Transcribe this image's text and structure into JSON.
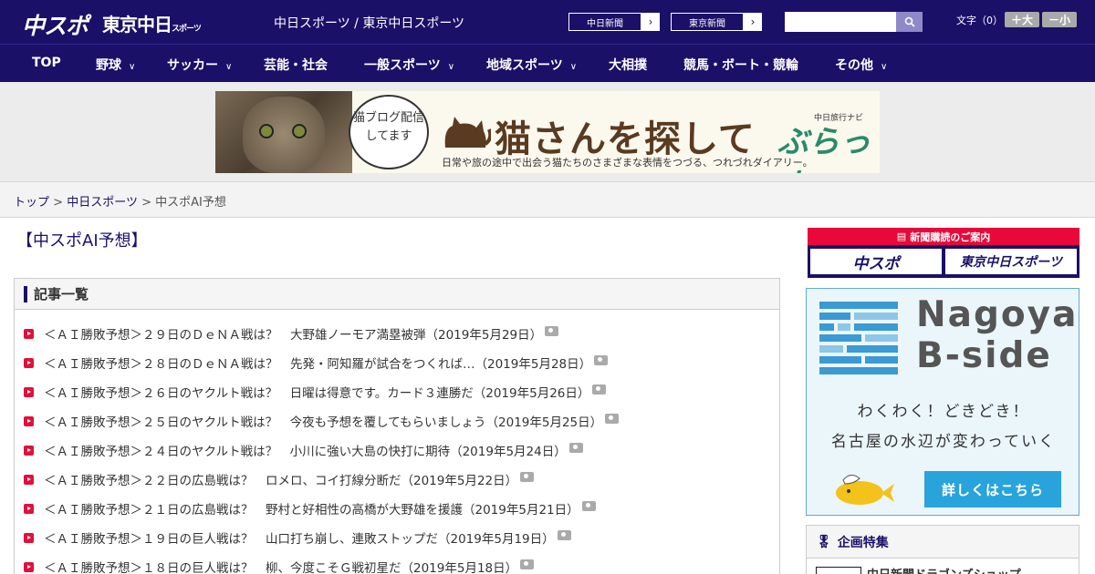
{
  "header": {
    "logo_main": "中スポ",
    "logo_tokyo": "東京中日",
    "logo_tokyo_small": "スポーツ",
    "site_title": "中日スポーツ / 東京中日スポーツ",
    "btn_chunichi": "中日新聞",
    "btn_tokyo": "東京新聞",
    "search_placeholder": "",
    "font_size_label": "文字（0）",
    "font_bigger": "＋大",
    "font_smaller": "－小"
  },
  "nav": {
    "items": [
      {
        "label": "TOP",
        "chevron": false
      },
      {
        "label": "野球",
        "chevron": true
      },
      {
        "label": "サッカー",
        "chevron": true
      },
      {
        "label": "芸能・社会",
        "chevron": false
      },
      {
        "label": "一般スポーツ",
        "chevron": true
      },
      {
        "label": "地域スポーツ",
        "chevron": true
      },
      {
        "label": "大相撲",
        "chevron": false
      },
      {
        "label": "競馬・ボート・競輪",
        "chevron": false
      },
      {
        "label": "その他",
        "chevron": true
      }
    ]
  },
  "banner": {
    "bubble_text": "猫ブログ配信してます",
    "title": "猫さんを探して",
    "subtitle": "日常や旅の途中で出会う猫たちのさまざまな表情をつづる、つれづれダイアリー。",
    "brand_small": "中日旅行ナビ",
    "brand": "ぶらっ人"
  },
  "breadcrumb": {
    "top": "トップ",
    "sep": ">",
    "chunichi_sports": "中日スポーツ",
    "current": "中スポAI予想"
  },
  "page": {
    "title": "【中スポAI予想】"
  },
  "articles": {
    "heading": "記事一覧",
    "items": [
      "＜ＡＩ勝敗予想＞２９日のＤｅＮＡ戦は？　大野雄ノーモア満塁被弾（2019年5月29日）",
      "＜ＡＩ勝敗予想＞２８日のＤｅＮＡ戦は？　先発・阿知羅が試合をつくれば…（2019年5月28日）",
      "＜ＡＩ勝敗予想＞２６日のヤクルト戦は？　日曜は得意です。カード３連勝だ（2019年5月26日）",
      "＜ＡＩ勝敗予想＞２５日のヤクルト戦は？　今夜も予想を覆してもらいましょう（2019年5月25日）",
      "＜ＡＩ勝敗予想＞２４日のヤクルト戦は？　小川に強い大島の快打に期待（2019年5月24日）",
      "＜ＡＩ勝敗予想＞２２日の広島戦は？　ロメロ、コイ打線分断だ（2019年5月22日）",
      "＜ＡＩ勝敗予想＞２１日の広島戦は？　野村と好相性の高橋が大野雄を援護（2019年5月21日）",
      "＜ＡＩ勝敗予想＞１９日の巨人戦は？　山口打ち崩し、連敗ストップだ（2019年5月19日）",
      "＜ＡＩ勝敗予想＞１８日の巨人戦は？　柳、今度こそＧ戦初星だ（2019年5月18日）"
    ]
  },
  "sidebar": {
    "subscribe_head": "新聞購読のご案内",
    "subscribe_logo1": "中スポ",
    "subscribe_logo2": "東京中日スポーツ",
    "nagoya_line1": "Nagoya",
    "nagoya_line2": "B-side",
    "nagoya_text1": "わくわく！どきどき！",
    "nagoya_text2": "名古屋の水辺が変わっていく",
    "nagoya_button": "詳しくはこちら",
    "kikaku_head": "企画特集",
    "kikaku_item": "中日新聞ドラゴンズショップ"
  },
  "colors": {
    "navy": "#1a1068",
    "accent_red": "#e0103a",
    "nagoya_blue": "#29a3dc"
  }
}
